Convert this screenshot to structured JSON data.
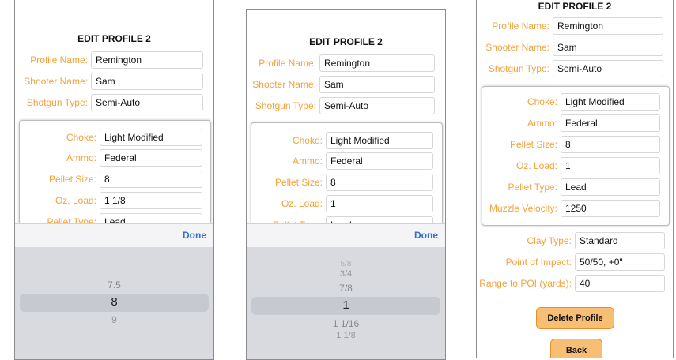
{
  "title": "EDIT PROFILE 2",
  "profile": {
    "name_label": "Profile Name:",
    "name_value": "Remington",
    "shooter_label": "Shooter Name:",
    "shooter_value": "Sam",
    "type_label": "Shotgun Type:",
    "type_value": "Semi-Auto"
  },
  "ammo": {
    "choke_label": "Choke:",
    "choke_value": "Light Modified",
    "ammo_label": "Ammo:",
    "ammo_value": "Federal",
    "pellet_size_label": "Pellet Size:",
    "pellet_size_value": "8",
    "oz_label": "Oz. Load:",
    "pellet_type_label": "Pellet Type:",
    "pellet_type_value": "Lead",
    "pellet_type_label_clipped": "Pellet Type:",
    "pellet_type_value_clipped": "Lead",
    "velocity_label": "Muzzle Velocity:",
    "velocity_value": "1250"
  },
  "screen1": {
    "oz_value": "1 1/8"
  },
  "screen2": {
    "oz_value": "1"
  },
  "screen3": {
    "oz_value": "1"
  },
  "toolbar": {
    "done_label": "Done"
  },
  "picker1": {
    "above": "7.5",
    "selected": "8",
    "below": "9"
  },
  "picker2": {
    "above3": "5/8",
    "above2": "3/4",
    "above1": "7/8",
    "selected": "1",
    "below1": "1 1/16",
    "below2": "1 1/8"
  },
  "target": {
    "clay_label": "Clay Type:",
    "clay_value": "Standard",
    "poi_label": "Point of Impact:",
    "poi_value": "50/50, +0\"",
    "range_label": "Range to POI (yards):",
    "range_value": "40"
  },
  "buttons": {
    "delete": "Delete Profile",
    "back": "Back"
  },
  "colors": {
    "label": "#f3a23c",
    "button": "#f8be74",
    "done": "#2f6fd6"
  }
}
